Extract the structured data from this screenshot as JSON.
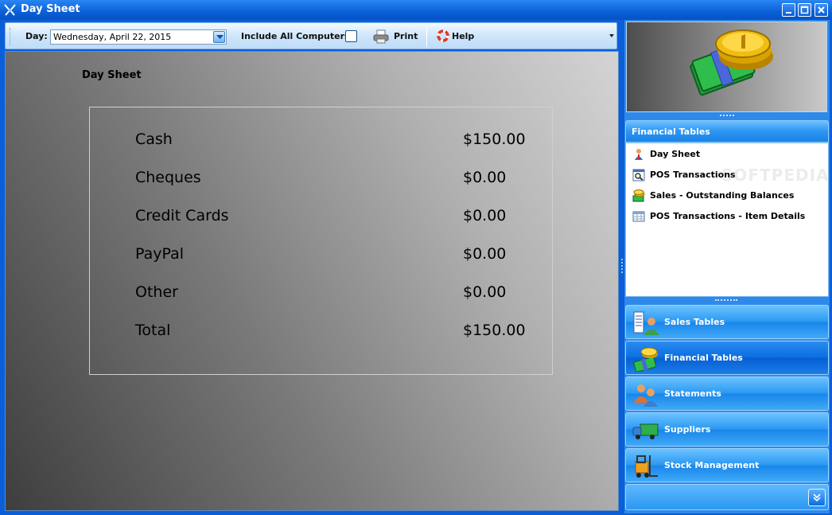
{
  "window": {
    "title": "Day Sheet"
  },
  "toolbar": {
    "day_label": "Day:",
    "day_value": "Wednesday, April 22, 2015",
    "include_all_label": "Include All Computers",
    "include_all_checked": false,
    "print_label": "Print",
    "help_label": "Help"
  },
  "sheet": {
    "title": "Day Sheet",
    "rows": [
      {
        "label": "Cash",
        "amount": "$150.00"
      },
      {
        "label": "Cheques",
        "amount": "$0.00"
      },
      {
        "label": "Credit Cards",
        "amount": "$0.00"
      },
      {
        "label": "PayPal",
        "amount": "$0.00"
      },
      {
        "label": "Other",
        "amount": "$0.00"
      },
      {
        "label": "Total",
        "amount": "$150.00"
      }
    ]
  },
  "sidebar": {
    "group_title": "Financial Tables",
    "items": [
      {
        "label": "Day Sheet",
        "icon": "person-icon"
      },
      {
        "label": "POS Transactions",
        "icon": "search-document-icon"
      },
      {
        "label": "Sales - Outstanding Balances",
        "icon": "coins-icon"
      },
      {
        "label": "POS Transactions - Item Details",
        "icon": "table-icon"
      }
    ],
    "watermark": "SOFTPEDIA",
    "sections": [
      {
        "label": "Sales Tables",
        "icon": "sales-tables-icon",
        "active": false
      },
      {
        "label": "Financial Tables",
        "icon": "financial-tables-icon",
        "active": true
      },
      {
        "label": "Statements",
        "icon": "statements-icon",
        "active": false
      },
      {
        "label": "Suppliers",
        "icon": "truck-icon",
        "active": false
      },
      {
        "label": "Stock Management",
        "icon": "forklift-icon",
        "active": false
      }
    ]
  },
  "colors": {
    "titlebar": "#0a5fd8",
    "accent": "#2b9af3",
    "active_section": "#0b6fe0"
  }
}
